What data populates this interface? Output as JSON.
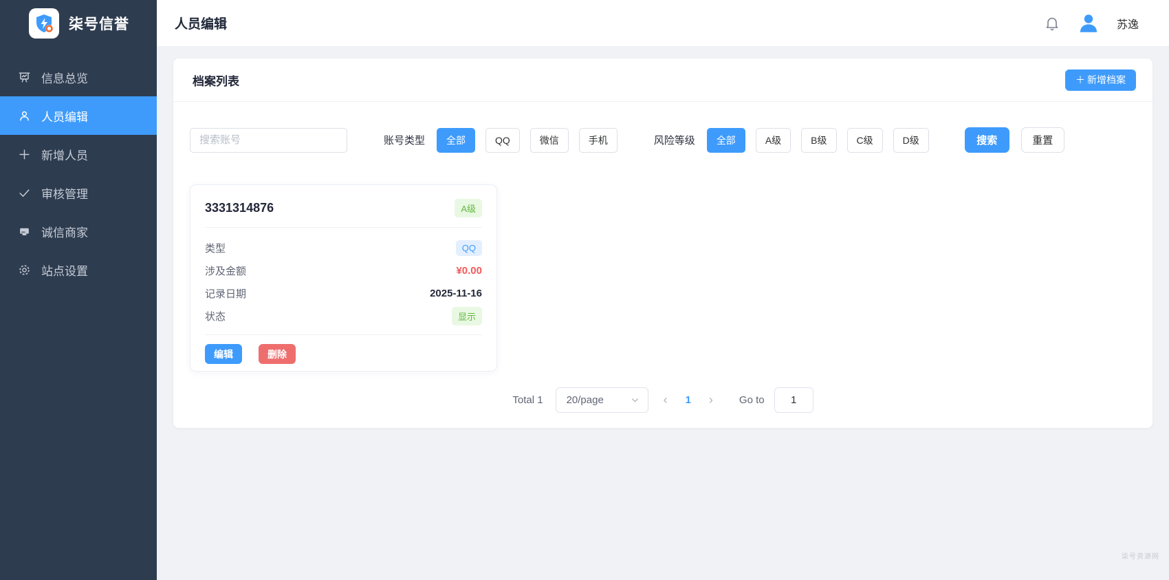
{
  "brand": {
    "name": "柒号信誉"
  },
  "sidebar": {
    "items": [
      {
        "label": "信息总览",
        "icon": "dashboard-icon",
        "active": false
      },
      {
        "label": "人员编辑",
        "icon": "user-edit-icon",
        "active": true
      },
      {
        "label": "新增人员",
        "icon": "plus-icon",
        "active": false
      },
      {
        "label": "审核管理",
        "icon": "check-icon",
        "active": false
      },
      {
        "label": "诚信商家",
        "icon": "merchant-icon",
        "active": false
      },
      {
        "label": "站点设置",
        "icon": "settings-icon",
        "active": false
      }
    ]
  },
  "header": {
    "title": "人员编辑",
    "username": "苏逸"
  },
  "panel": {
    "title": "档案列表",
    "add_plus": "＋",
    "add_label": "新增档案",
    "filters": {
      "search_placeholder": "搜索账号",
      "account_type_label": "账号类型",
      "account_type_options": {
        "0": "全部",
        "1": "QQ",
        "2": "微信",
        "3": "手机"
      },
      "account_type_active": "全部",
      "risk_label": "风险等级",
      "risk_options": {
        "0": "全部",
        "1": "A级",
        "2": "B级",
        "3": "C级",
        "4": "D级"
      },
      "risk_active": "全部",
      "search_button": "搜索",
      "reset_button": "重置"
    },
    "record": {
      "account": "3331314876",
      "level_badge": "A级",
      "rows": [
        {
          "label": "类型",
          "value": "QQ"
        },
        {
          "label": "涉及金额",
          "value": "¥0.00"
        },
        {
          "label": "记录日期",
          "value": "2025-11-16"
        },
        {
          "label": "状态",
          "value": "显示"
        }
      ],
      "edit_button": "编辑",
      "delete_button": "删除"
    },
    "pagination": {
      "total": "Total 1",
      "per_page": "20/page",
      "prev": "‹",
      "page": "1",
      "next": "›",
      "goto_label": "Go to",
      "goto_value": "1"
    }
  },
  "watermark": "柒号资源网",
  "colors": {
    "sidebar_bg": "#2e3c50",
    "accent_blue": "#3e9bfc",
    "danger_red": "#ee6e6e",
    "money_red": "#f25a5a",
    "badge_green_bg": "#e9f8e2",
    "badge_green_text": "#60b83f",
    "badge_blue_bg": "#e3efff",
    "content_bg": "#f0f2f5"
  }
}
